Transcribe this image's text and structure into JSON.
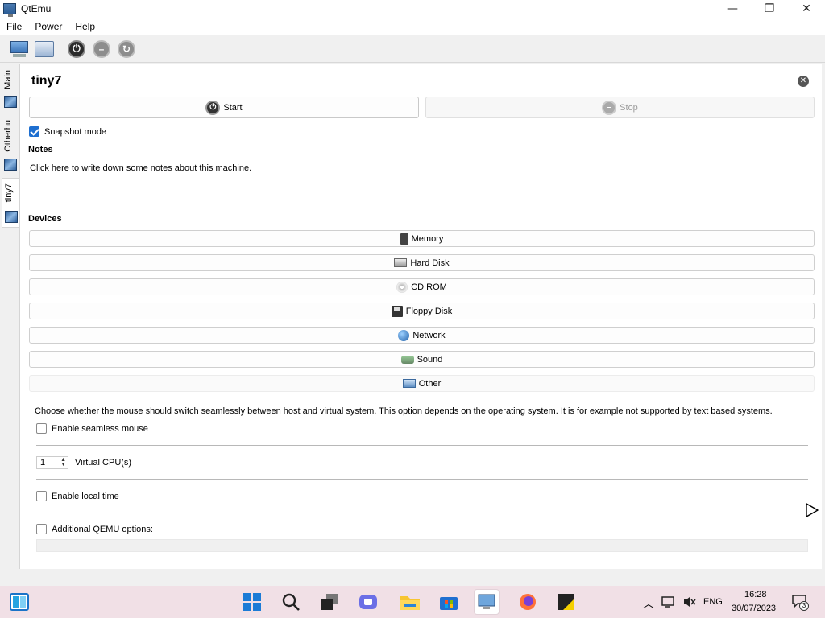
{
  "window": {
    "title": "QtEmu"
  },
  "menu": {
    "file": "File",
    "power": "Power",
    "help": "Help"
  },
  "tabs": {
    "main": "Main",
    "otherhu": "Otherhu",
    "tiny7": "tiny7"
  },
  "machine": {
    "name": "tiny7",
    "start_label": "Start",
    "stop_label": "Stop",
    "snapshot_label": "Snapshot mode",
    "snapshot_checked": true
  },
  "notes": {
    "title": "Notes",
    "placeholder": "Click here to write down some notes about this machine."
  },
  "devices": {
    "title": "Devices",
    "items": [
      "Memory",
      "Hard Disk",
      "CD ROM",
      "Floppy Disk",
      "Network",
      "Sound",
      "Other"
    ]
  },
  "other": {
    "mouse_description": "Choose whether the mouse should switch seamlessly between host and virtual system. This option depends on the operating system. It is for example not supported by text based systems.",
    "seamless_label": "Enable seamless mouse",
    "cpu_value": "1",
    "cpu_label": "Virtual CPU(s)",
    "localtime_label": "Enable local time",
    "qemu_label": "Additional QEMU options:"
  },
  "taskbar": {
    "language": "ENG",
    "time": "16:28",
    "date": "30/07/2023",
    "notification_count": "3"
  }
}
